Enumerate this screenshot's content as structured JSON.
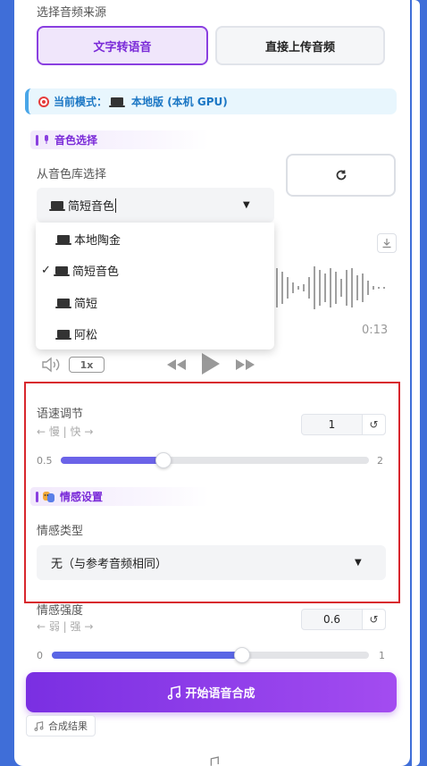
{
  "source": {
    "label": "选择音频来源",
    "tabs": [
      {
        "label": "文字转语音",
        "active": true
      },
      {
        "label": "直接上传音频",
        "active": false
      }
    ]
  },
  "mode": {
    "prefix": "当前模式：",
    "value": "本地版 (本机 GPU)"
  },
  "voice_section": {
    "title": "音色选择",
    "library_label": "从音色库选择",
    "selected": "简短音色",
    "options": [
      {
        "label": "本地陶金",
        "checked": false
      },
      {
        "label": "简短音色",
        "checked": true
      },
      {
        "label": "简短",
        "checked": false
      },
      {
        "label": "阿松",
        "checked": false
      }
    ]
  },
  "player": {
    "time": "0:13",
    "speed": "1x"
  },
  "speed_control": {
    "label": "语速调节",
    "hint": "← 慢 | 快 →",
    "value": "1",
    "min": "0.5",
    "max": "2",
    "fraction": 0.333
  },
  "emotion_section": {
    "title": "情感设置",
    "type_label": "情感类型",
    "type_value": "无（与参考音频相同）"
  },
  "intensity_control": {
    "label": "情感强度",
    "hint": "← 弱 | 强 →",
    "value": "0.6",
    "min": "0",
    "max": "1",
    "fraction": 0.6
  },
  "actions": {
    "synthesize": "开始语音合成",
    "result_tag": "合成结果"
  },
  "icons": {
    "refresh": "refresh-icon",
    "download": "download-icon",
    "volume": "volume-icon",
    "rewind": "rewind-icon",
    "play": "play-icon",
    "forward": "forward-icon",
    "reset": "reset-icon",
    "music": "music-note-icon",
    "laptop": "laptop-icon",
    "target": "target-icon"
  },
  "colors": {
    "accent": "#8a3fe0",
    "highlight_border": "#d8262d",
    "mode_text": "#1a76c4"
  }
}
